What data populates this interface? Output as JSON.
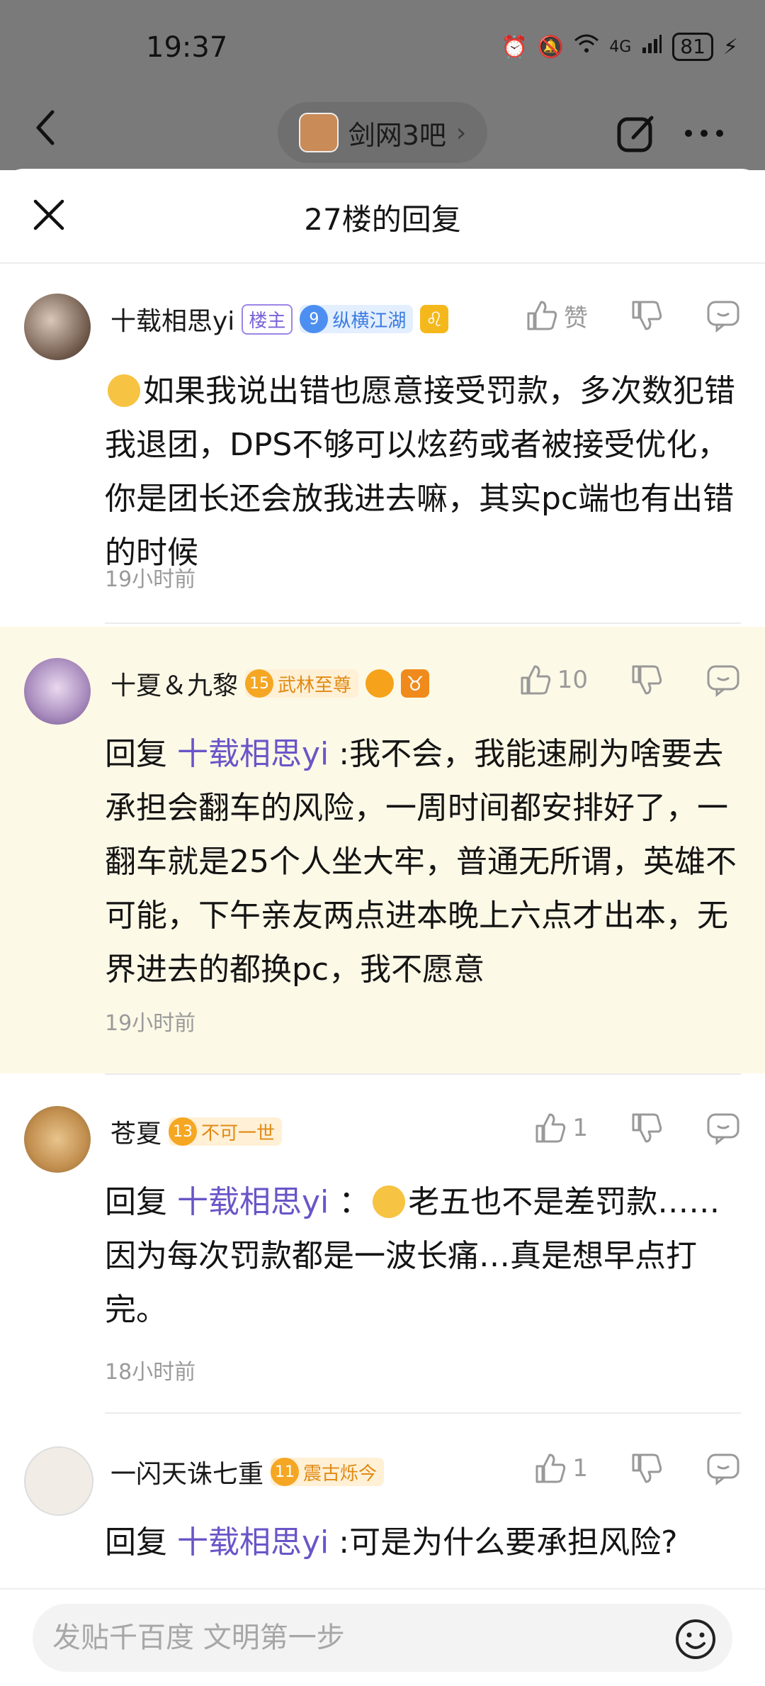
{
  "status": {
    "time": "19:37",
    "signal": "4G",
    "wifi_sup": "6",
    "battery": "81"
  },
  "header": {
    "forum_name": "剑网3吧"
  },
  "sheet": {
    "title": "27楼的回复"
  },
  "comments": [
    {
      "user": "十载相思yi",
      "tag": "楼主",
      "level": "9",
      "title": "纵横江湖",
      "like_label": "赞",
      "text": "如果我说出错也愿意接受罚款，多次数犯错我退团，DPS不够可以炫药或者被接受优化，你是团长还会放我进去嘛，其实pc端也有出错的时候",
      "time": "19小时前"
    },
    {
      "user": "十夏＆九黎",
      "level": "15",
      "title": "武林至尊",
      "like_count": "10",
      "reply_prefix": "回复",
      "mention": "十载相思yi",
      "text": ":我不会，我能速刷为啥要去承担会翻车的风险，一周时间都安排好了，一翻车就是25个人坐大牢，普通无所谓，英雄不可能，下午亲友两点进本晚上六点才出本，无界进去的都换pc，我不愿意",
      "time": "19小时前"
    },
    {
      "user": "苍夏",
      "level": "13",
      "title": "不可一世",
      "like_count": "1",
      "reply_prefix": "回复",
      "mention": "十载相思yi",
      "text": "老五也不是差罚款……因为每次罚款都是一波长痛…真是想早点打完。",
      "time": "18小时前"
    },
    {
      "user": "一闪天诛七重",
      "level": "11",
      "title": "震古烁今",
      "like_count": "1",
      "reply_prefix": "回复",
      "mention": "十载相思yi",
      "text": ":可是为什么要承担风险?"
    }
  ],
  "bottom": {
    "placeholder": "发贴千百度 文明第一步"
  }
}
